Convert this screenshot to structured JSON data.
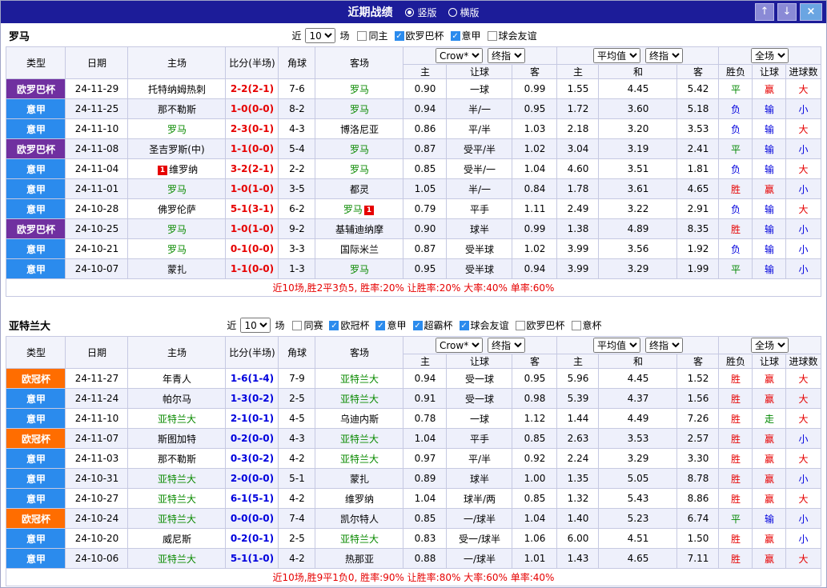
{
  "titlebar": {
    "title": "近期战绩",
    "layout_options": [
      {
        "label": "竖版",
        "selected": true
      },
      {
        "label": "横版",
        "selected": false
      }
    ],
    "buttons": {
      "up_icon": "↑",
      "down_icon": "↓",
      "close_icon": "×"
    }
  },
  "filter": {
    "prefix": "近",
    "count": "10",
    "suffix": "场"
  },
  "table_header": {
    "main_cols": [
      "类型",
      "日期",
      "主场",
      "比分(半场)",
      "角球",
      "客场"
    ],
    "sub_cols": [
      "主",
      "让球",
      "客",
      "主",
      "和",
      "客",
      "胜负",
      "让球",
      "进球数"
    ],
    "handicap_selects": [
      "Crow*",
      "终指"
    ],
    "europe_selects": [
      "平均值",
      "终指"
    ],
    "scope_select": "全场"
  },
  "colors": {
    "titlebar_bg": "#1c1c99",
    "accent_red": "#e60000",
    "accent_blue": "#0000dd",
    "accent_green": "#008800",
    "team_green": "#0a8a00",
    "league_europa": "#7030a0",
    "league_seriea": "#2b8bed",
    "league_ucl": "#ff6d00"
  },
  "sections": [
    {
      "team": "罗马",
      "checkboxes": [
        {
          "label": "同主",
          "checked": false
        },
        {
          "label": "欧罗巴杯",
          "checked": true
        },
        {
          "label": "意甲",
          "checked": true
        },
        {
          "label": "球会友谊",
          "checked": false
        }
      ],
      "rows": [
        {
          "league": "欧罗巴杯",
          "league_key": "uefa",
          "date": "24-11-29",
          "home": "托特纳姆热刺",
          "home_is_team": false,
          "home_red_cards": "",
          "score": "2-2(2-1)",
          "score_color": "red",
          "corners": "7-6",
          "away": "罗马",
          "away_is_team": true,
          "away_red_cards": "",
          "handicap_home": "0.90",
          "handicap_line": "一球",
          "handicap_away": "0.99",
          "euro_home": "1.55",
          "euro_draw": "4.45",
          "euro_away": "5.42",
          "result": "平",
          "result_color": "green",
          "handicap_result": "赢",
          "handicap_result_color": "red",
          "goals_result": "大",
          "goals_result_color": "red"
        },
        {
          "league": "意甲",
          "league_key": "seriea",
          "date": "24-11-25",
          "home": "那不勒斯",
          "home_is_team": false,
          "home_red_cards": "",
          "score": "1-0(0-0)",
          "score_color": "red",
          "corners": "8-2",
          "away": "罗马",
          "away_is_team": true,
          "away_red_cards": "",
          "handicap_home": "0.94",
          "handicap_line": "半/一",
          "handicap_away": "0.95",
          "euro_home": "1.72",
          "euro_draw": "3.60",
          "euro_away": "5.18",
          "result": "负",
          "result_color": "blue",
          "handicap_result": "输",
          "handicap_result_color": "blue",
          "goals_result": "小",
          "goals_result_color": "blue"
        },
        {
          "league": "意甲",
          "league_key": "seriea",
          "date": "24-11-10",
          "home": "罗马",
          "home_is_team": true,
          "home_red_cards": "",
          "score": "2-3(0-1)",
          "score_color": "red",
          "corners": "4-3",
          "away": "博洛尼亚",
          "away_is_team": false,
          "away_red_cards": "",
          "handicap_home": "0.86",
          "handicap_line": "平/半",
          "handicap_away": "1.03",
          "euro_home": "2.18",
          "euro_draw": "3.20",
          "euro_away": "3.53",
          "result": "负",
          "result_color": "blue",
          "handicap_result": "输",
          "handicap_result_color": "blue",
          "goals_result": "大",
          "goals_result_color": "red"
        },
        {
          "league": "欧罗巴杯",
          "league_key": "uefa",
          "date": "24-11-08",
          "home": "圣吉罗斯(中)",
          "home_is_team": false,
          "home_red_cards": "",
          "score": "1-1(0-0)",
          "score_color": "red",
          "corners": "5-4",
          "away": "罗马",
          "away_is_team": true,
          "away_red_cards": "",
          "handicap_home": "0.87",
          "handicap_line": "受平/半",
          "handicap_away": "1.02",
          "euro_home": "3.04",
          "euro_draw": "3.19",
          "euro_away": "2.41",
          "result": "平",
          "result_color": "green",
          "handicap_result": "输",
          "handicap_result_color": "blue",
          "goals_result": "小",
          "goals_result_color": "blue"
        },
        {
          "league": "意甲",
          "league_key": "seriea",
          "date": "24-11-04",
          "home": "维罗纳",
          "home_is_team": false,
          "home_red_cards": "1",
          "score": "3-2(2-1)",
          "score_color": "red",
          "corners": "2-2",
          "away": "罗马",
          "away_is_team": true,
          "away_red_cards": "",
          "handicap_home": "0.85",
          "handicap_line": "受半/一",
          "handicap_away": "1.04",
          "euro_home": "4.60",
          "euro_draw": "3.51",
          "euro_away": "1.81",
          "result": "负",
          "result_color": "blue",
          "handicap_result": "输",
          "handicap_result_color": "blue",
          "goals_result": "大",
          "goals_result_color": "red"
        },
        {
          "league": "意甲",
          "league_key": "seriea",
          "date": "24-11-01",
          "home": "罗马",
          "home_is_team": true,
          "home_red_cards": "",
          "score": "1-0(1-0)",
          "score_color": "red",
          "corners": "3-5",
          "away": "都灵",
          "away_is_team": false,
          "away_red_cards": "",
          "handicap_home": "1.05",
          "handicap_line": "半/一",
          "handicap_away": "0.84",
          "euro_home": "1.78",
          "euro_draw": "3.61",
          "euro_away": "4.65",
          "result": "胜",
          "result_color": "red",
          "handicap_result": "赢",
          "handicap_result_color": "red",
          "goals_result": "小",
          "goals_result_color": "blue"
        },
        {
          "league": "意甲",
          "league_key": "seriea",
          "date": "24-10-28",
          "home": "佛罗伦萨",
          "home_is_team": false,
          "home_red_cards": "",
          "score": "5-1(3-1)",
          "score_color": "red",
          "corners": "6-2",
          "away": "罗马",
          "away_is_team": true,
          "away_red_cards": "1",
          "handicap_home": "0.79",
          "handicap_line": "平手",
          "handicap_away": "1.11",
          "euro_home": "2.49",
          "euro_draw": "3.22",
          "euro_away": "2.91",
          "result": "负",
          "result_color": "blue",
          "handicap_result": "输",
          "handicap_result_color": "blue",
          "goals_result": "大",
          "goals_result_color": "red"
        },
        {
          "league": "欧罗巴杯",
          "league_key": "uefa",
          "date": "24-10-25",
          "home": "罗马",
          "home_is_team": true,
          "home_red_cards": "",
          "score": "1-0(1-0)",
          "score_color": "red",
          "corners": "9-2",
          "away": "基辅迪纳摩",
          "away_is_team": false,
          "away_red_cards": "",
          "handicap_home": "0.90",
          "handicap_line": "球半",
          "handicap_away": "0.99",
          "euro_home": "1.38",
          "euro_draw": "4.89",
          "euro_away": "8.35",
          "result": "胜",
          "result_color": "red",
          "handicap_result": "输",
          "handicap_result_color": "blue",
          "goals_result": "小",
          "goals_result_color": "blue"
        },
        {
          "league": "意甲",
          "league_key": "seriea",
          "date": "24-10-21",
          "home": "罗马",
          "home_is_team": true,
          "home_red_cards": "",
          "score": "0-1(0-0)",
          "score_color": "red",
          "corners": "3-3",
          "away": "国际米兰",
          "away_is_team": false,
          "away_red_cards": "",
          "handicap_home": "0.87",
          "handicap_line": "受半球",
          "handicap_away": "1.02",
          "euro_home": "3.99",
          "euro_draw": "3.56",
          "euro_away": "1.92",
          "result": "负",
          "result_color": "blue",
          "handicap_result": "输",
          "handicap_result_color": "blue",
          "goals_result": "小",
          "goals_result_color": "blue"
        },
        {
          "league": "意甲",
          "league_key": "seriea",
          "date": "24-10-07",
          "home": "蒙扎",
          "home_is_team": false,
          "home_red_cards": "",
          "score": "1-1(0-0)",
          "score_color": "red",
          "corners": "1-3",
          "away": "罗马",
          "away_is_team": true,
          "away_red_cards": "",
          "handicap_home": "0.95",
          "handicap_line": "受半球",
          "handicap_away": "0.94",
          "euro_home": "3.99",
          "euro_draw": "3.29",
          "euro_away": "1.99",
          "result": "平",
          "result_color": "green",
          "handicap_result": "输",
          "handicap_result_color": "blue",
          "goals_result": "小",
          "goals_result_color": "blue"
        }
      ],
      "summary": "近10场,胜2平3负5, 胜率:20% 让胜率:20% 大率:40% 单率:60%"
    },
    {
      "team": "亚特兰大",
      "checkboxes": [
        {
          "label": "同赛",
          "checked": false
        },
        {
          "label": "欧冠杯",
          "checked": true
        },
        {
          "label": "意甲",
          "checked": true
        },
        {
          "label": "超霸杯",
          "checked": true
        },
        {
          "label": "球会友谊",
          "checked": true
        },
        {
          "label": "欧罗巴杯",
          "checked": false
        },
        {
          "label": "意杯",
          "checked": false
        }
      ],
      "rows": [
        {
          "league": "欧冠杯",
          "league_key": "ucl",
          "date": "24-11-27",
          "home": "年青人",
          "home_is_team": false,
          "home_red_cards": "",
          "score": "1-6(1-4)",
          "score_color": "blue",
          "corners": "7-9",
          "away": "亚特兰大",
          "away_is_team": true,
          "away_red_cards": "",
          "handicap_home": "0.94",
          "handicap_line": "受一球",
          "handicap_away": "0.95",
          "euro_home": "5.96",
          "euro_draw": "4.45",
          "euro_away": "1.52",
          "result": "胜",
          "result_color": "red",
          "handicap_result": "赢",
          "handicap_result_color": "red",
          "goals_result": "大",
          "goals_result_color": "red"
        },
        {
          "league": "意甲",
          "league_key": "seriea",
          "date": "24-11-24",
          "home": "帕尔马",
          "home_is_team": false,
          "home_red_cards": "",
          "score": "1-3(0-2)",
          "score_color": "blue",
          "corners": "2-5",
          "away": "亚特兰大",
          "away_is_team": true,
          "away_red_cards": "",
          "handicap_home": "0.91",
          "handicap_line": "受一球",
          "handicap_away": "0.98",
          "euro_home": "5.39",
          "euro_draw": "4.37",
          "euro_away": "1.56",
          "result": "胜",
          "result_color": "red",
          "handicap_result": "赢",
          "handicap_result_color": "red",
          "goals_result": "大",
          "goals_result_color": "red"
        },
        {
          "league": "意甲",
          "league_key": "seriea",
          "date": "24-11-10",
          "home": "亚特兰大",
          "home_is_team": true,
          "home_red_cards": "",
          "score": "2-1(0-1)",
          "score_color": "blue",
          "corners": "4-5",
          "away": "乌迪内斯",
          "away_is_team": false,
          "away_red_cards": "",
          "handicap_home": "0.78",
          "handicap_line": "一球",
          "handicap_away": "1.12",
          "euro_home": "1.44",
          "euro_draw": "4.49",
          "euro_away": "7.26",
          "result": "胜",
          "result_color": "red",
          "handicap_result": "走",
          "handicap_result_color": "green",
          "goals_result": "大",
          "goals_result_color": "red"
        },
        {
          "league": "欧冠杯",
          "league_key": "ucl",
          "date": "24-11-07",
          "home": "斯图加特",
          "home_is_team": false,
          "home_red_cards": "",
          "score": "0-2(0-0)",
          "score_color": "blue",
          "corners": "4-3",
          "away": "亚特兰大",
          "away_is_team": true,
          "away_red_cards": "",
          "handicap_home": "1.04",
          "handicap_line": "平手",
          "handicap_away": "0.85",
          "euro_home": "2.63",
          "euro_draw": "3.53",
          "euro_away": "2.57",
          "result": "胜",
          "result_color": "red",
          "handicap_result": "赢",
          "handicap_result_color": "red",
          "goals_result": "小",
          "goals_result_color": "blue"
        },
        {
          "league": "意甲",
          "league_key": "seriea",
          "date": "24-11-03",
          "home": "那不勒斯",
          "home_is_team": false,
          "home_red_cards": "",
          "score": "0-3(0-2)",
          "score_color": "blue",
          "corners": "4-2",
          "away": "亚特兰大",
          "away_is_team": true,
          "away_red_cards": "",
          "handicap_home": "0.97",
          "handicap_line": "平/半",
          "handicap_away": "0.92",
          "euro_home": "2.24",
          "euro_draw": "3.29",
          "euro_away": "3.30",
          "result": "胜",
          "result_color": "red",
          "handicap_result": "赢",
          "handicap_result_color": "red",
          "goals_result": "大",
          "goals_result_color": "red"
        },
        {
          "league": "意甲",
          "league_key": "seriea",
          "date": "24-10-31",
          "home": "亚特兰大",
          "home_is_team": true,
          "home_red_cards": "",
          "score": "2-0(0-0)",
          "score_color": "blue",
          "corners": "5-1",
          "away": "蒙扎",
          "away_is_team": false,
          "away_red_cards": "",
          "handicap_home": "0.89",
          "handicap_line": "球半",
          "handicap_away": "1.00",
          "euro_home": "1.35",
          "euro_draw": "5.05",
          "euro_away": "8.78",
          "result": "胜",
          "result_color": "red",
          "handicap_result": "赢",
          "handicap_result_color": "red",
          "goals_result": "小",
          "goals_result_color": "blue"
        },
        {
          "league": "意甲",
          "league_key": "seriea",
          "date": "24-10-27",
          "home": "亚特兰大",
          "home_is_team": true,
          "home_red_cards": "",
          "score": "6-1(5-1)",
          "score_color": "blue",
          "corners": "4-2",
          "away": "维罗纳",
          "away_is_team": false,
          "away_red_cards": "",
          "handicap_home": "1.04",
          "handicap_line": "球半/两",
          "handicap_away": "0.85",
          "euro_home": "1.32",
          "euro_draw": "5.43",
          "euro_away": "8.86",
          "result": "胜",
          "result_color": "red",
          "handicap_result": "赢",
          "handicap_result_color": "red",
          "goals_result": "大",
          "goals_result_color": "red"
        },
        {
          "league": "欧冠杯",
          "league_key": "ucl",
          "date": "24-10-24",
          "home": "亚特兰大",
          "home_is_team": true,
          "home_red_cards": "",
          "score": "0-0(0-0)",
          "score_color": "blue",
          "corners": "7-4",
          "away": "凯尔特人",
          "away_is_team": false,
          "away_red_cards": "",
          "handicap_home": "0.85",
          "handicap_line": "一/球半",
          "handicap_away": "1.04",
          "euro_home": "1.40",
          "euro_draw": "5.23",
          "euro_away": "6.74",
          "result": "平",
          "result_color": "green",
          "handicap_result": "输",
          "handicap_result_color": "blue",
          "goals_result": "小",
          "goals_result_color": "blue"
        },
        {
          "league": "意甲",
          "league_key": "seriea",
          "date": "24-10-20",
          "home": "威尼斯",
          "home_is_team": false,
          "home_red_cards": "",
          "score": "0-2(0-1)",
          "score_color": "blue",
          "corners": "2-5",
          "away": "亚特兰大",
          "away_is_team": true,
          "away_red_cards": "",
          "handicap_home": "0.83",
          "handicap_line": "受一/球半",
          "handicap_away": "1.06",
          "euro_home": "6.00",
          "euro_draw": "4.51",
          "euro_away": "1.50",
          "result": "胜",
          "result_color": "red",
          "handicap_result": "赢",
          "handicap_result_color": "red",
          "goals_result": "小",
          "goals_result_color": "blue"
        },
        {
          "league": "意甲",
          "league_key": "seriea",
          "date": "24-10-06",
          "home": "亚特兰大",
          "home_is_team": true,
          "home_red_cards": "",
          "score": "5-1(1-0)",
          "score_color": "blue",
          "corners": "4-2",
          "away": "热那亚",
          "away_is_team": false,
          "away_red_cards": "",
          "handicap_home": "0.88",
          "handicap_line": "一/球半",
          "handicap_away": "1.01",
          "euro_home": "1.43",
          "euro_draw": "4.65",
          "euro_away": "7.11",
          "result": "胜",
          "result_color": "red",
          "handicap_result": "赢",
          "handicap_result_color": "red",
          "goals_result": "大",
          "goals_result_color": "red"
        }
      ],
      "summary": "近10场,胜9平1负0, 胜率:90% 让胜率:80% 大率:60% 单率:40%"
    }
  ]
}
